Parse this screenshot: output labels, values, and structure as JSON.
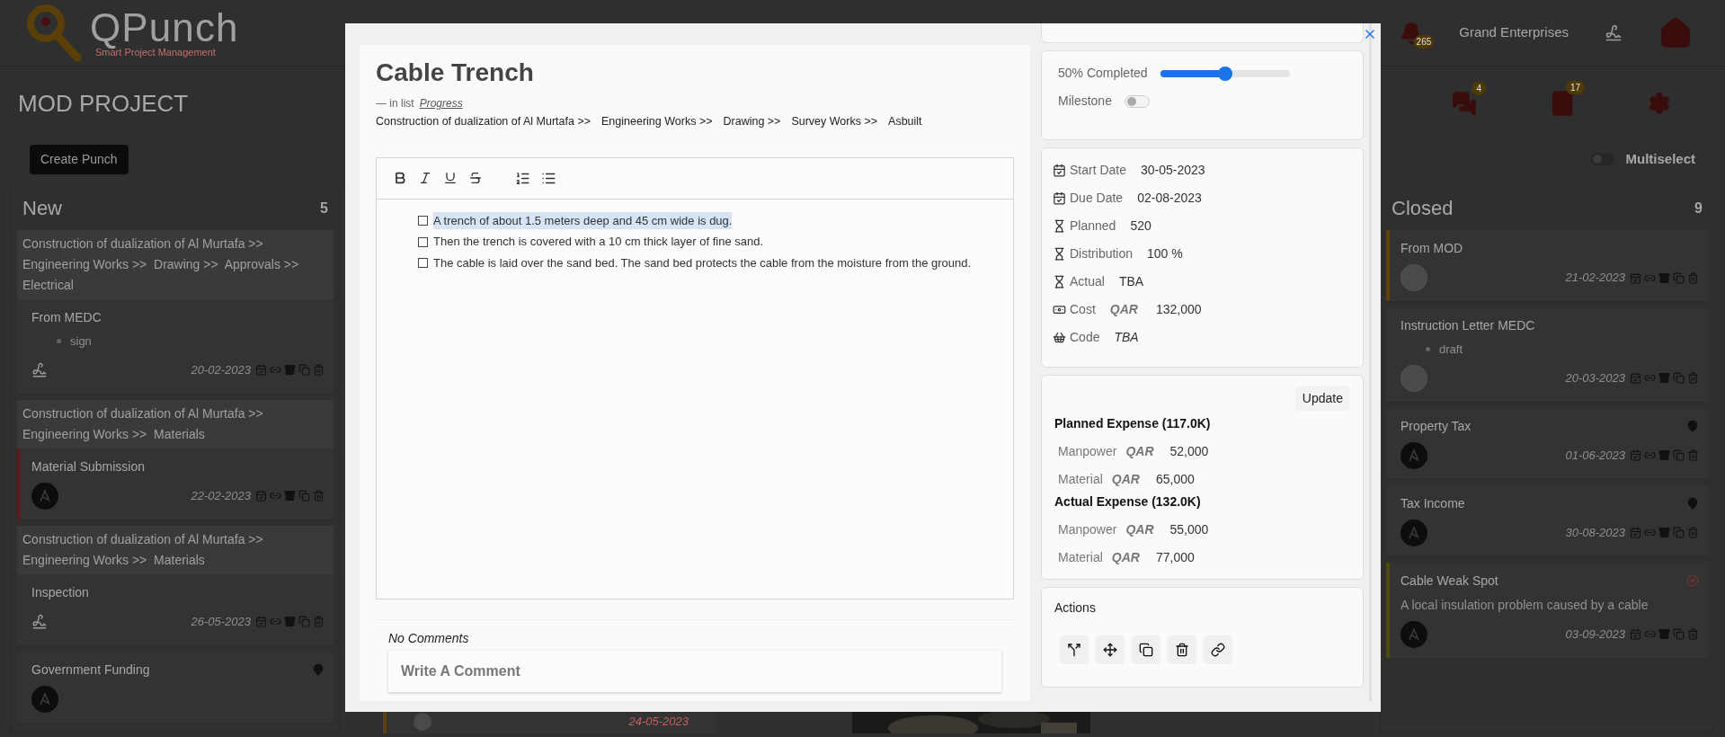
{
  "header": {
    "logo_title": "QPunch",
    "logo_subtitle": "Smart Project Management",
    "notification_count": "265",
    "company": "Grand Enterprises"
  },
  "toolbar": {
    "project_title": "MOD PROJECT",
    "badges": [
      {
        "kind": "chat",
        "count": "4"
      },
      {
        "kind": "book",
        "count": "17"
      }
    ],
    "create_button": "Create Punch",
    "multiselect": {
      "label": "Multiselect",
      "on": false
    }
  },
  "columns": [
    {
      "title": "New",
      "count": "5",
      "cards": [
        {
          "path": "Construction of dualization of Al Murtafa >>  Engineering Works >>  Drawing >>  Approvals >>  Electrical",
          "title": "From MEDC",
          "bullets": [
            "sign"
          ],
          "kind": "signature",
          "pinned": false,
          "removable": false,
          "date": "20-02-2023"
        },
        {
          "path": "Construction of dualization of Al Murtafa >>  Engineering Works >>  Materials",
          "title": "Material Submission",
          "kind": "logo",
          "pinned": false,
          "removable": false,
          "date": "22-02-2023",
          "color": "#5a1c1c"
        },
        {
          "path": "Construction of dualization of Al Murtafa >>  Engineering Works >>  Materials",
          "title": "Inspection",
          "kind": "signature",
          "pinned": false,
          "removable": false,
          "date": "26-05-2023"
        },
        {
          "title": "Government Funding",
          "kind": "logo",
          "pinned": true,
          "removable": false
        }
      ]
    },
    {
      "title": "Closed",
      "count": "9",
      "cards": [
        {
          "title": "From MOD",
          "pinned": false,
          "removable": false,
          "date": "21-02-2023",
          "color": "#5e4208"
        },
        {
          "title": "Instruction Letter MEDC",
          "bullets": [
            "draft"
          ],
          "pinned": false,
          "removable": false,
          "date": "20-03-2023"
        },
        {
          "title": "Property Tax",
          "kind": "logo",
          "pinned": true,
          "removable": false,
          "date": "01-06-2023"
        },
        {
          "title": "Tax Income",
          "kind": "logo",
          "pinned": true,
          "removable": false,
          "date": "30-08-2023"
        },
        {
          "title": "Cable Weak Spot",
          "description": "A local insulation problem caused by a cable",
          "kind": "logo",
          "pinned": false,
          "removable": true,
          "date": "03-09-2023",
          "color": "#4a4a0c"
        }
      ]
    }
  ],
  "hidden_board": {
    "date": "24-05-2023"
  },
  "modal": {
    "title": "Cable Trench",
    "list_prefix": "— in list",
    "list_name": "Progress",
    "breadcrumb": [
      "Construction of dualization of Al Murtafa >>",
      "Engineering Works >>",
      "Drawing >>",
      "Survey Works >>",
      "Asbuilt"
    ],
    "items": [
      {
        "text": "A trench of about 1.5 meters deep and 45 cm wide is dug.",
        "checked": false,
        "selected": true
      },
      {
        "text": "Then the trench is covered with a 10 cm thick layer of fine sand.",
        "checked": false,
        "selected": false
      },
      {
        "text": "The cable is laid over the sand bed. The sand bed protects the cable from the moisture from the ground.",
        "checked": false,
        "selected": false
      }
    ],
    "comments_empty": "No Comments",
    "comment_placeholder": "Write A Comment",
    "progress": {
      "label": "50% Completed",
      "level": 0.5
    },
    "milestone": {
      "label": "Milestone",
      "on": false
    },
    "details": [
      {
        "kind": "calendar",
        "label": "Start Date",
        "value": "30-05-2023",
        "emphasis": false
      },
      {
        "kind": "calendar",
        "label": "Due Date",
        "value": "02-08-2023",
        "emphasis": false
      },
      {
        "kind": "hourglass",
        "label": "Planned",
        "value": "520",
        "emphasis": false
      },
      {
        "kind": "hourglass",
        "label": "Distribution",
        "value": "100 %",
        "emphasis": false
      },
      {
        "kind": "hourglass",
        "label": "Actual",
        "value": "TBA",
        "emphasis": false
      },
      {
        "kind": "money",
        "label": "Cost",
        "currency": "QAR",
        "value": "132,000",
        "emphasis": false
      },
      {
        "kind": "basket",
        "label": "Code",
        "value": "TBA",
        "emphasis": true
      }
    ],
    "update_button": "Update",
    "expenses": [
      {
        "title": "Planned Expense (117.0K)",
        "lines": [
          {
            "label": "Manpower",
            "currency": "QAR",
            "value": "52,000"
          },
          {
            "label": "Material",
            "currency": "QAR",
            "value": "65,000"
          }
        ]
      },
      {
        "title": "Actual Expense (132.0K)",
        "lines": [
          {
            "label": "Manpower",
            "currency": "QAR",
            "value": "55,000"
          },
          {
            "label": "Material",
            "currency": "QAR",
            "value": "77,000"
          }
        ]
      }
    ],
    "actions_title": "Actions"
  }
}
